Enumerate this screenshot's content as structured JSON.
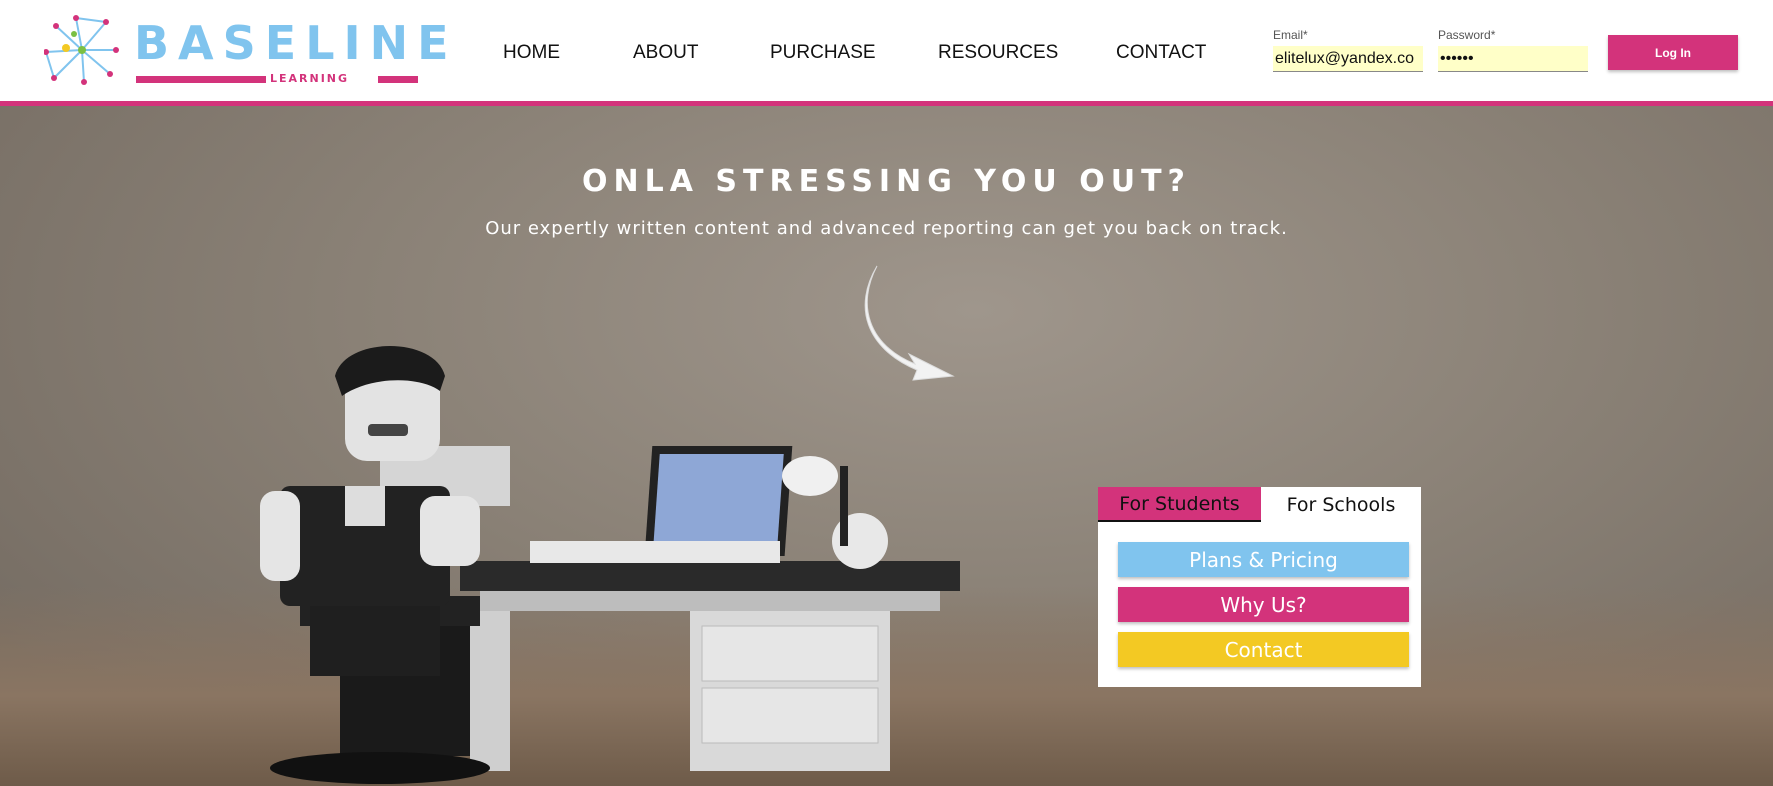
{
  "logo": {
    "word": "BASELINE",
    "sub": "LEARNING",
    "pink": "#d3337b",
    "blue": "#80c4ee"
  },
  "nav": [
    "HOME",
    "ABOUT",
    "PURCHASE",
    "RESOURCES",
    "CONTACT"
  ],
  "login": {
    "email_label": "Email*",
    "email_value": "elitelux@yandex.co",
    "password_label": "Password*",
    "password_value": "••••••",
    "button": "Log In"
  },
  "hero": {
    "title": "ONLA STRESSING YOU OUT?",
    "subtitle": "Our expertly written content and advanced reporting can get you back on track."
  },
  "panel": {
    "tabs": [
      "For Students",
      "For Schools"
    ],
    "active_tab": "For Students",
    "buttons": [
      {
        "label": "Plans & Pricing",
        "color": "#80c4ee"
      },
      {
        "label": "Why Us?",
        "color": "#d3337b"
      },
      {
        "label": "Contact",
        "color": "#f3c923"
      }
    ]
  }
}
